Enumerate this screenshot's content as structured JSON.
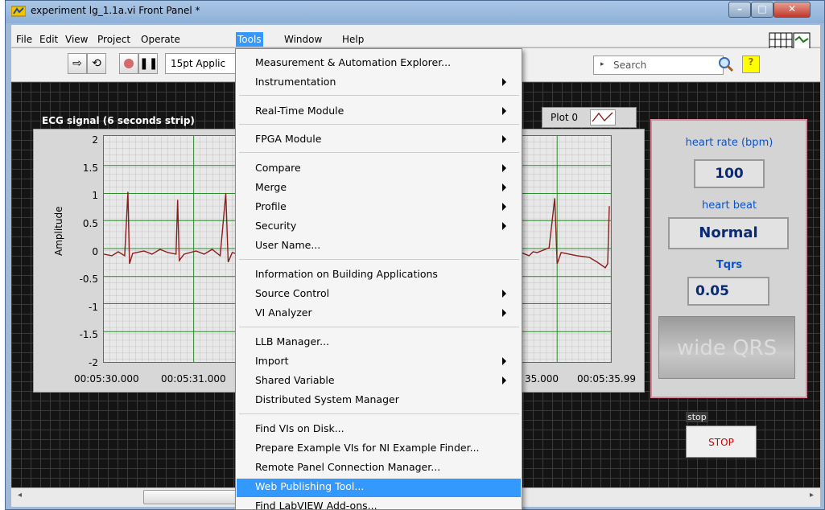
{
  "window": {
    "title": "experiment lg_1.1a.vi Front Panel *"
  },
  "menubar": {
    "items": [
      "File",
      "Edit",
      "View",
      "Project",
      "Operate",
      "Tools",
      "Window",
      "Help"
    ],
    "active": "Tools"
  },
  "toolbar": {
    "font_select": "15pt Applic",
    "search_placeholder": "Search"
  },
  "chart": {
    "title": "ECG signal (6 seconds strip)",
    "legend_plot": "Plot 0",
    "ylabel": "Amplitude",
    "y_ticks": [
      "2",
      "1.5",
      "1",
      "0.5",
      "0",
      "-0.5",
      "-1",
      "-1.5",
      "-2"
    ],
    "x_ticks": [
      "00:05:30.000",
      "00:05:31.000",
      "35.000",
      "00:05:35.99"
    ]
  },
  "indicators": {
    "heart_rate_label": "heart rate (bpm)",
    "heart_rate_value": "100",
    "heart_beat_label": "heart beat",
    "heart_beat_value": "Normal",
    "tqrs_label": "Tqrs",
    "tqrs_value": "0.05",
    "wide_qrs_label": "wide QRS"
  },
  "stop": {
    "label": "stop",
    "button": "STOP"
  },
  "tools_menu": {
    "items": [
      {
        "label": "Measurement & Automation Explorer...",
        "submenu": false
      },
      {
        "label": "Instrumentation",
        "submenu": true
      },
      {
        "label": "Real-Time Module",
        "submenu": true
      },
      {
        "label": "FPGA Module",
        "submenu": true
      },
      {
        "label": "Compare",
        "submenu": true
      },
      {
        "label": "Merge",
        "submenu": true
      },
      {
        "label": "Profile",
        "submenu": true
      },
      {
        "label": "Security",
        "submenu": true
      },
      {
        "label": "User Name...",
        "submenu": false
      },
      {
        "label": "Information on Building Applications",
        "submenu": false
      },
      {
        "label": "Source Control",
        "submenu": true
      },
      {
        "label": "VI Analyzer",
        "submenu": true
      },
      {
        "label": "LLB Manager...",
        "submenu": false
      },
      {
        "label": "Import",
        "submenu": true
      },
      {
        "label": "Shared Variable",
        "submenu": true
      },
      {
        "label": "Distributed System Manager",
        "submenu": false
      },
      {
        "label": "Find VIs on Disk...",
        "submenu": false
      },
      {
        "label": "Prepare Example VIs for NI Example Finder...",
        "submenu": false
      },
      {
        "label": "Remote Panel Connection Manager...",
        "submenu": false
      },
      {
        "label": "Web Publishing Tool...",
        "submenu": false,
        "highlighted": true
      },
      {
        "label": "Find LabVIEW Add-ons...",
        "submenu": false
      }
    ]
  }
}
